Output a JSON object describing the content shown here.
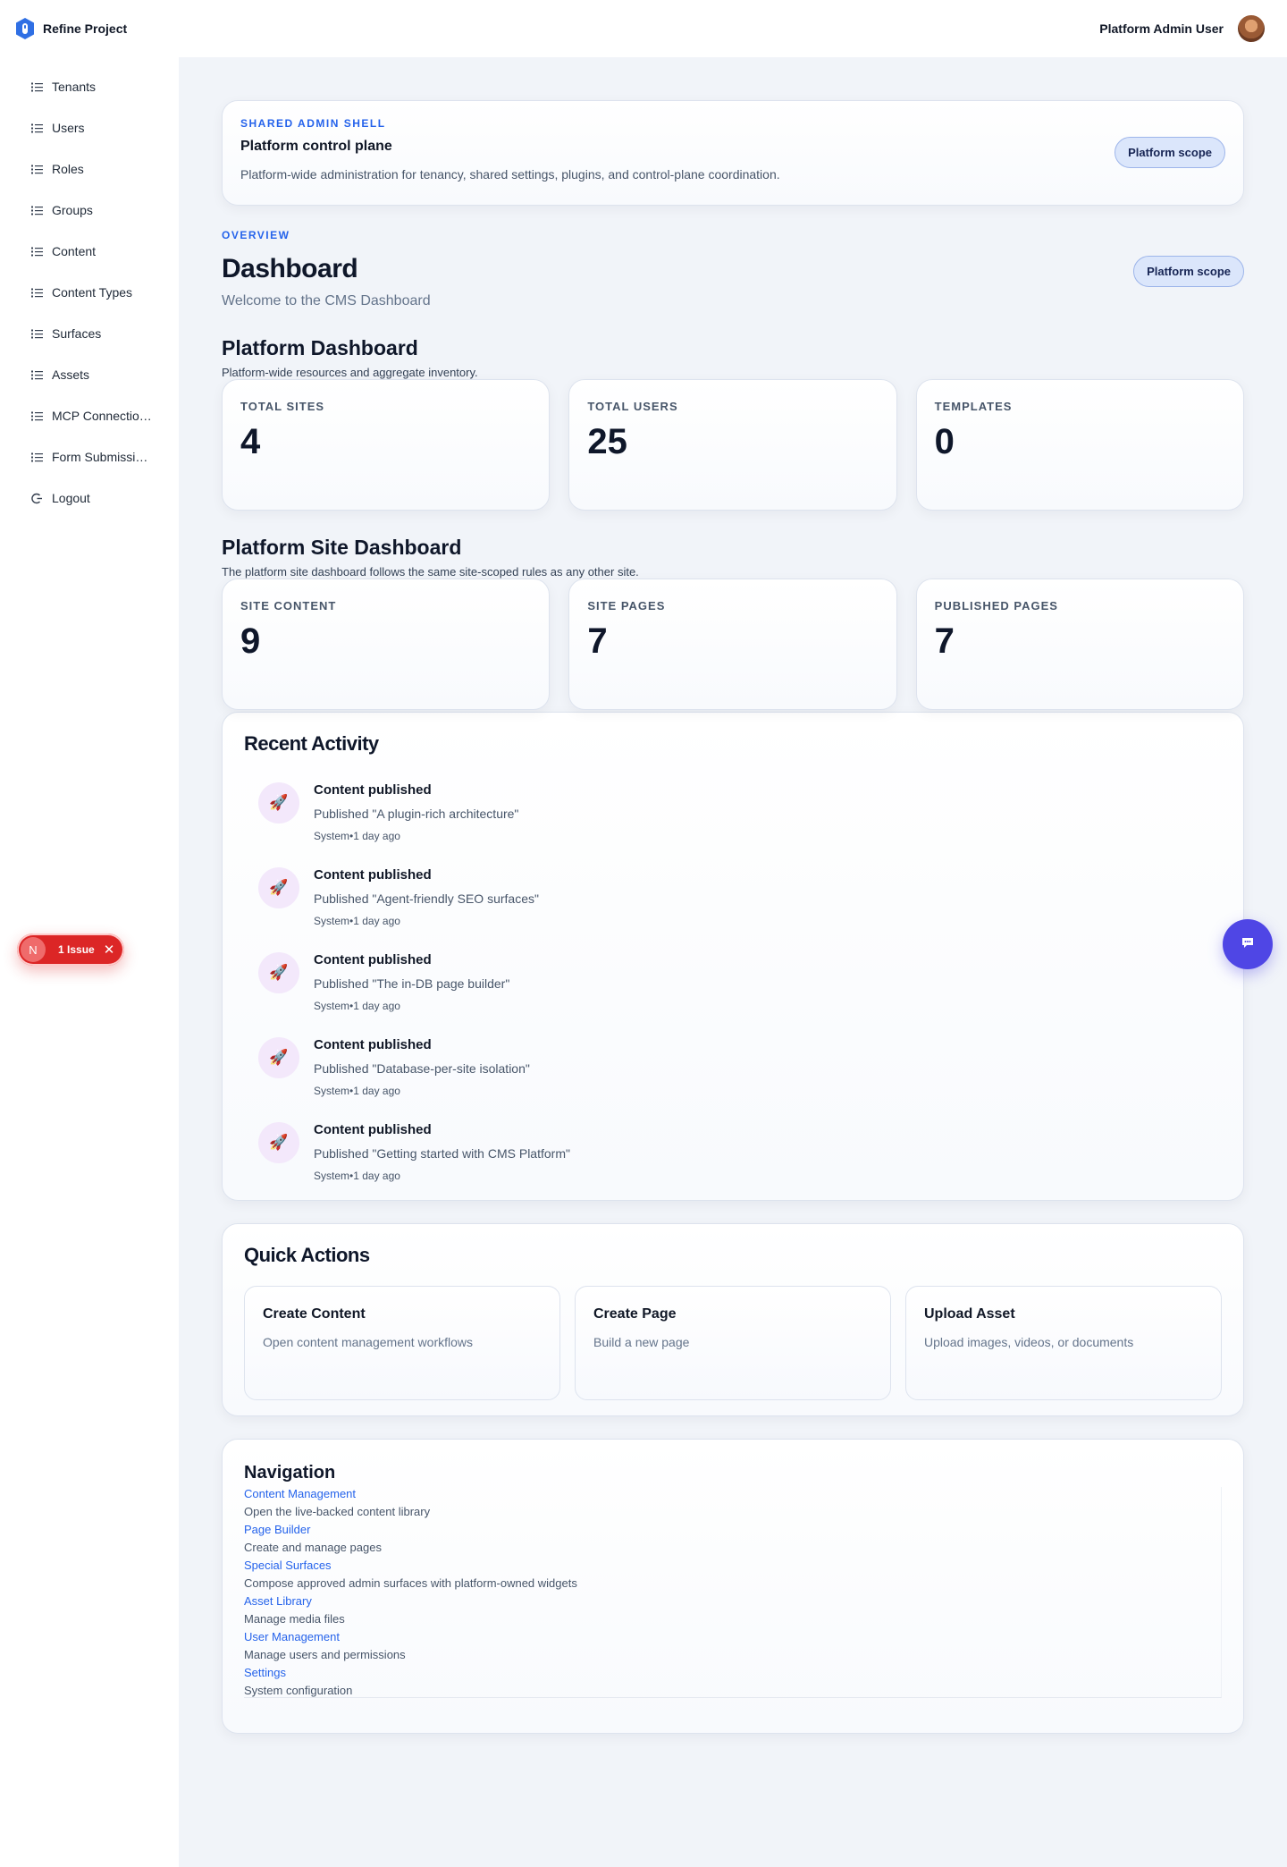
{
  "header": {
    "app_name": "Refine Project",
    "user_name": "Platform Admin User"
  },
  "sidebar": {
    "items": [
      {
        "label": "Tenants",
        "icon": "list-icon"
      },
      {
        "label": "Users",
        "icon": "list-icon"
      },
      {
        "label": "Roles",
        "icon": "list-icon"
      },
      {
        "label": "Groups",
        "icon": "list-icon"
      },
      {
        "label": "Content",
        "icon": "list-icon"
      },
      {
        "label": "Content Types",
        "icon": "list-icon"
      },
      {
        "label": "Surfaces",
        "icon": "list-icon"
      },
      {
        "label": "Assets",
        "icon": "list-icon"
      },
      {
        "label": "MCP Connections",
        "icon": "list-icon"
      },
      {
        "label": "Form Submissi…",
        "icon": "list-icon"
      },
      {
        "label": "Logout",
        "icon": "logout-icon"
      }
    ]
  },
  "shell": {
    "eyebrow": "SHARED ADMIN SHELL",
    "title": "Platform control plane",
    "description": "Platform-wide administration for tenancy, shared settings, plugins, and control-plane coordination.",
    "scope_badge": "Platform scope"
  },
  "overview": {
    "eyebrow": "OVERVIEW",
    "title": "Dashboard",
    "subtitle": "Welcome to the CMS Dashboard",
    "scope_badge": "Platform scope"
  },
  "platform_dashboard": {
    "title": "Platform Dashboard",
    "description": "Platform-wide resources and aggregate inventory.",
    "stats": [
      {
        "label": "TOTAL SITES",
        "value": "4"
      },
      {
        "label": "TOTAL USERS",
        "value": "25"
      },
      {
        "label": "TEMPLATES",
        "value": "0"
      }
    ]
  },
  "site_dashboard": {
    "title": "Platform Site Dashboard",
    "description": "The platform site dashboard follows the same site-scoped rules as any other site.",
    "stats": [
      {
        "label": "SITE CONTENT",
        "value": "9"
      },
      {
        "label": "SITE PAGES",
        "value": "7"
      },
      {
        "label": "PUBLISHED PAGES",
        "value": "7"
      }
    ]
  },
  "recent_activity": {
    "title": "Recent Activity",
    "items": [
      {
        "icon": "🚀",
        "title": "Content published",
        "description": "Published \"A plugin-rich architecture\"",
        "meta": "System•1 day ago"
      },
      {
        "icon": "🚀",
        "title": "Content published",
        "description": "Published \"Agent-friendly SEO surfaces\"",
        "meta": "System•1 day ago"
      },
      {
        "icon": "🚀",
        "title": "Content published",
        "description": "Published \"The in-DB page builder\"",
        "meta": "System•1 day ago"
      },
      {
        "icon": "🚀",
        "title": "Content published",
        "description": "Published \"Database-per-site isolation\"",
        "meta": "System•1 day ago"
      },
      {
        "icon": "🚀",
        "title": "Content published",
        "description": "Published \"Getting started with CMS Platform\"",
        "meta": "System•1 day ago"
      }
    ]
  },
  "quick_actions": {
    "title": "Quick Actions",
    "items": [
      {
        "title": "Create Content",
        "description": "Open content management workflows"
      },
      {
        "title": "Create Page",
        "description": "Build a new page"
      },
      {
        "title": "Upload Asset",
        "description": "Upload images, videos, or documents"
      }
    ]
  },
  "navigation": {
    "title": "Navigation",
    "items": [
      {
        "link": "Content Management",
        "description": "Open the live-backed content library"
      },
      {
        "link": "Page Builder",
        "description": "Create and manage pages"
      },
      {
        "link": "Special Surfaces",
        "description": "Compose approved admin surfaces with platform-owned widgets"
      },
      {
        "link": "Asset Library",
        "description": "Manage media files"
      },
      {
        "link": "User Management",
        "description": "Manage users and permissions"
      },
      {
        "link": "Settings",
        "description": "System configuration"
      }
    ]
  },
  "issue_badge": {
    "initial": "N",
    "label": "1 Issue"
  },
  "colors": {
    "accent": "#2563eb",
    "chat_button": "#4f46e5",
    "issue_badge": "#dc2626"
  }
}
